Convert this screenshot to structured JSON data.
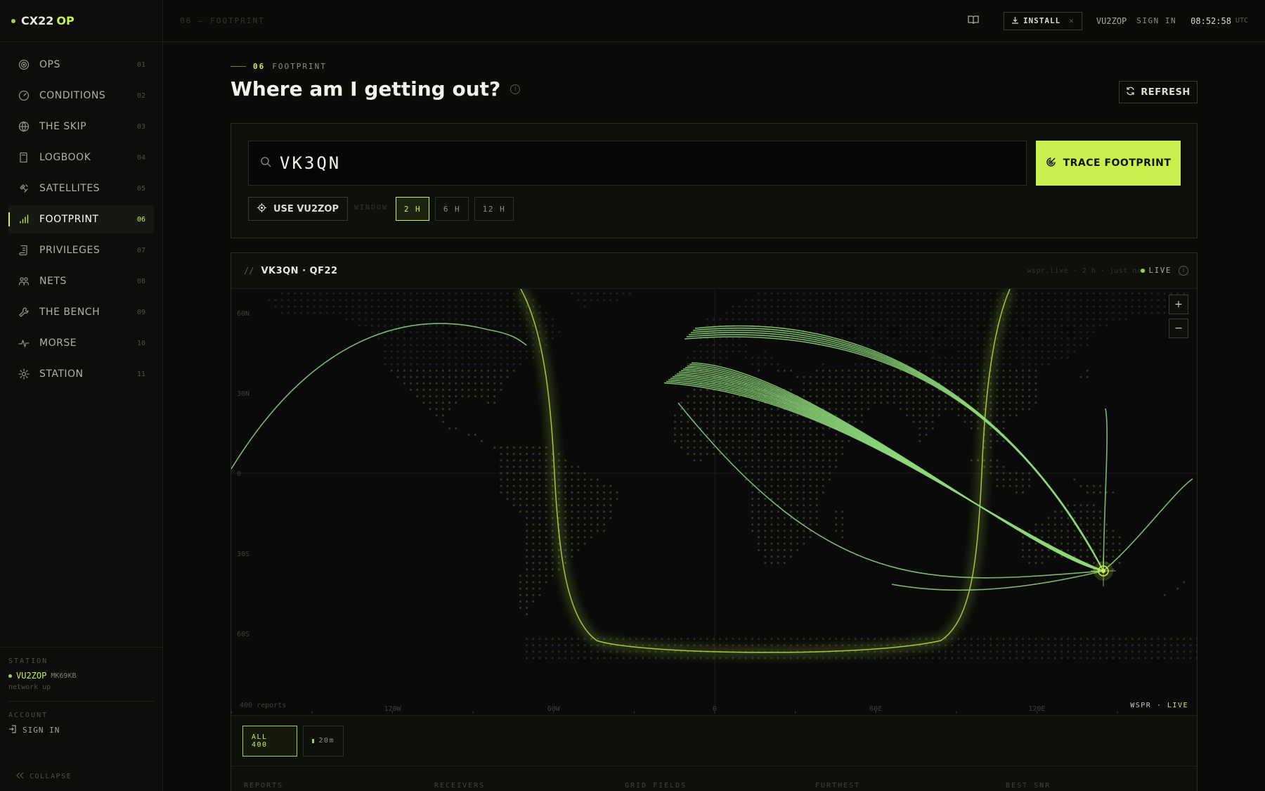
{
  "brand": {
    "name_a": "CX22",
    "name_b": "OP"
  },
  "nav": [
    {
      "label": "OPS",
      "num": "01",
      "icon": "radar-icon"
    },
    {
      "label": "CONDITIONS",
      "num": "02",
      "icon": "gauge-icon"
    },
    {
      "label": "THE SKIP",
      "num": "03",
      "icon": "globe-icon"
    },
    {
      "label": "LOGBOOK",
      "num": "04",
      "icon": "book-icon"
    },
    {
      "label": "SATELLITES",
      "num": "05",
      "icon": "satellite-icon"
    },
    {
      "label": "FOOTPRINT",
      "num": "06",
      "icon": "signal-bars-icon"
    },
    {
      "label": "PRIVILEGES",
      "num": "07",
      "icon": "scroll-icon"
    },
    {
      "label": "NETS",
      "num": "08",
      "icon": "people-icon"
    },
    {
      "label": "THE BENCH",
      "num": "09",
      "icon": "wrench-icon"
    },
    {
      "label": "MORSE",
      "num": "10",
      "icon": "pulse-icon"
    },
    {
      "label": "STATION",
      "num": "11",
      "icon": "gear-icon"
    }
  ],
  "sidebar_footer": {
    "station_label": "STATION",
    "callsign": "VU2ZOP",
    "grid": "MK69KB",
    "status": "network up",
    "account_label": "ACCOUNT",
    "sign_in": "SIGN IN",
    "collapse": "COLLAPSE"
  },
  "topbar": {
    "crumb": "06 — FOOTPRINT",
    "install": "INSTALL",
    "callsign": "VU2ZOP",
    "sign_in": "SIGN IN",
    "clock": "08:52:58",
    "tz": "UTC"
  },
  "page": {
    "eyebrow_num": "06",
    "eyebrow_text": "FOOTPRINT",
    "title": "Where am I getting out?",
    "refresh": "REFRESH"
  },
  "query": {
    "value": "VK3QN",
    "trace": "TRACE FOOTPRINT",
    "use_label": "USE VU2ZOP",
    "window_label": "WINDOW",
    "windows": [
      "2 H",
      "6 H",
      "12 H"
    ],
    "selected_window": "2 H"
  },
  "map_card": {
    "prefix": "//",
    "title": "VK3QN · QF22",
    "meta": "wspr.live · 2 h · just now",
    "live": "LIVE",
    "reports_caption": "400 reports",
    "tag_a": "WSPR",
    "tag_sep": " · ",
    "tag_b": "LIVE",
    "lat_labels": [
      "60N",
      "30N",
      "0",
      "30S",
      "60S"
    ],
    "lon_labels": [
      "120W",
      "60W",
      "0",
      "60E",
      "120E"
    ],
    "zoom_in": "+",
    "zoom_out": "−"
  },
  "filters": {
    "all": "ALL 400",
    "band": "20m"
  },
  "stats": [
    "REPORTS",
    "RECEIVERS",
    "GRID FIELDS",
    "FURTHEST",
    "BEST SNR"
  ],
  "colors": {
    "accent": "#c9f04d",
    "path": "#8ed87a",
    "terminator": "#b8e04a"
  }
}
